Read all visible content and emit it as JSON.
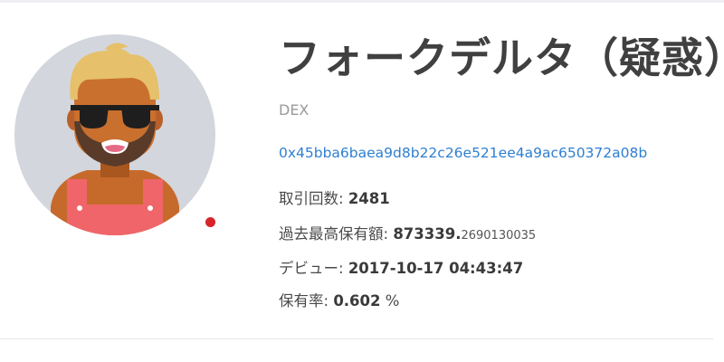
{
  "profile": {
    "name": "フォークデルタ（疑惑）",
    "type": "DEX",
    "address": "0x45bba6baea9d8b22c26e521ee4a9ac650372a08b",
    "status_color": "#d6262a",
    "avatar": "bearded-man-with-sunglasses"
  },
  "stats": {
    "trades_label": "取引回数:",
    "trades_value": "2481",
    "max_holding_label": "過去最高保有額:",
    "max_holding_int": "873339.",
    "max_holding_dec": "2690130035",
    "debut_label": "デビュー:",
    "debut_value": "2017-10-17 04:43:47",
    "holding_rate_label": "保有率:",
    "holding_rate_value": "0.602",
    "holding_rate_unit": "%"
  }
}
